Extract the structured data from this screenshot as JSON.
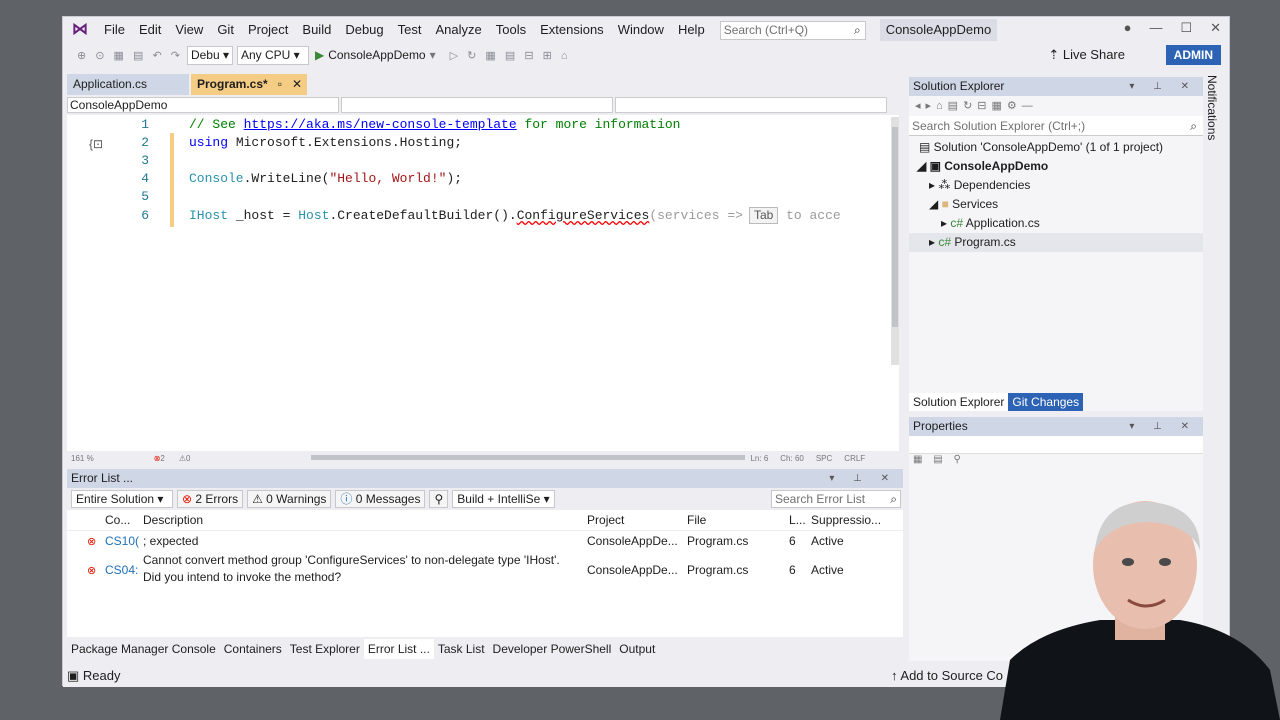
{
  "menu": [
    "File",
    "Edit",
    "View",
    "Git",
    "Project",
    "Build",
    "Debug",
    "Test",
    "Analyze",
    "Tools",
    "Extensions",
    "Window",
    "Help"
  ],
  "search_placeholder": "Search (Ctrl+Q)",
  "solution_title": "ConsoleAppDemo",
  "toolbar": {
    "config": "Debu",
    "platform": "Any CPU",
    "run_target": "ConsoleAppDemo",
    "live_share": "Live Share",
    "admin": "ADMIN"
  },
  "doc_tabs": [
    "Application.cs",
    "Program.cs*"
  ],
  "nav_combo": "ConsoleAppDemo",
  "code": {
    "l1_comment": "// See ",
    "l1_link": "https://aka.ms/new-console-template",
    "l1_rest": " for more information",
    "l2_kw": "using",
    "l2_rest": " Microsoft.Extensions.Hosting;",
    "l4_type": "Console",
    "l4_a": ".WriteLine(",
    "l4_str": "\"Hello, World!\"",
    "l4_b": ");",
    "l6_t1": "IHost",
    "l6_a": " _host = ",
    "l6_t2": "Host",
    "l6_b": ".CreateDefaultBuilder().",
    "l6_sq": "ConfigureServices",
    "l6_ghost": "(services =>",
    "l6_tab": "Tab",
    "l6_after": " to acce"
  },
  "line_numbers": [
    "1",
    "2",
    "3",
    "4",
    "5",
    "6"
  ],
  "editor_status": {
    "zoom": "161 %",
    "errors": "2",
    "warnings": "0",
    "ln": "Ln: 6",
    "ch": "Ch: 60",
    "spc": "SPC",
    "crlf": "CRLF"
  },
  "error_list": {
    "title": "Error List ...",
    "scope": "Entire Solution",
    "errors_btn": "2 Errors",
    "warnings_btn": "0 Warnings",
    "messages_btn": "0 Messages",
    "build_combo": "Build + IntelliSe",
    "search": "Search Error List",
    "columns": [
      "Co...",
      "Description",
      "Project",
      "File",
      "L...",
      "Suppressio..."
    ],
    "rows": [
      {
        "code": "CS10(",
        "desc": "; expected",
        "desc2": "",
        "project": "ConsoleAppDe...",
        "file": "Program.cs",
        "line": "6",
        "supp": "Active"
      },
      {
        "code": "CS04:",
        "desc": "Cannot convert method group 'ConfigureServices' to non-delegate type 'IHost'.",
        "desc2": "Did you intend to invoke the method?",
        "project": "ConsoleAppDe...",
        "file": "Program.cs",
        "line": "6",
        "supp": "Active"
      }
    ]
  },
  "bottom_tabs": [
    "Package Manager Console",
    "Containers",
    "Test Explorer",
    "Error List ...",
    "Task List",
    "Developer PowerShell",
    "Output"
  ],
  "status": {
    "ready": "Ready",
    "source": "Add to Source Co"
  },
  "solution_explorer": {
    "title": "Solution Explorer",
    "search": "Search Solution Explorer (Ctrl+;)",
    "tree": [
      "Solution 'ConsoleAppDemo' (1 of 1 project)",
      "ConsoleAppDemo",
      "Dependencies",
      "Services",
      "Application.cs",
      "Program.cs"
    ],
    "tabs": [
      "Solution Explorer",
      "Git Changes"
    ]
  },
  "properties": {
    "title": "Properties"
  },
  "notifications": "Notifications"
}
